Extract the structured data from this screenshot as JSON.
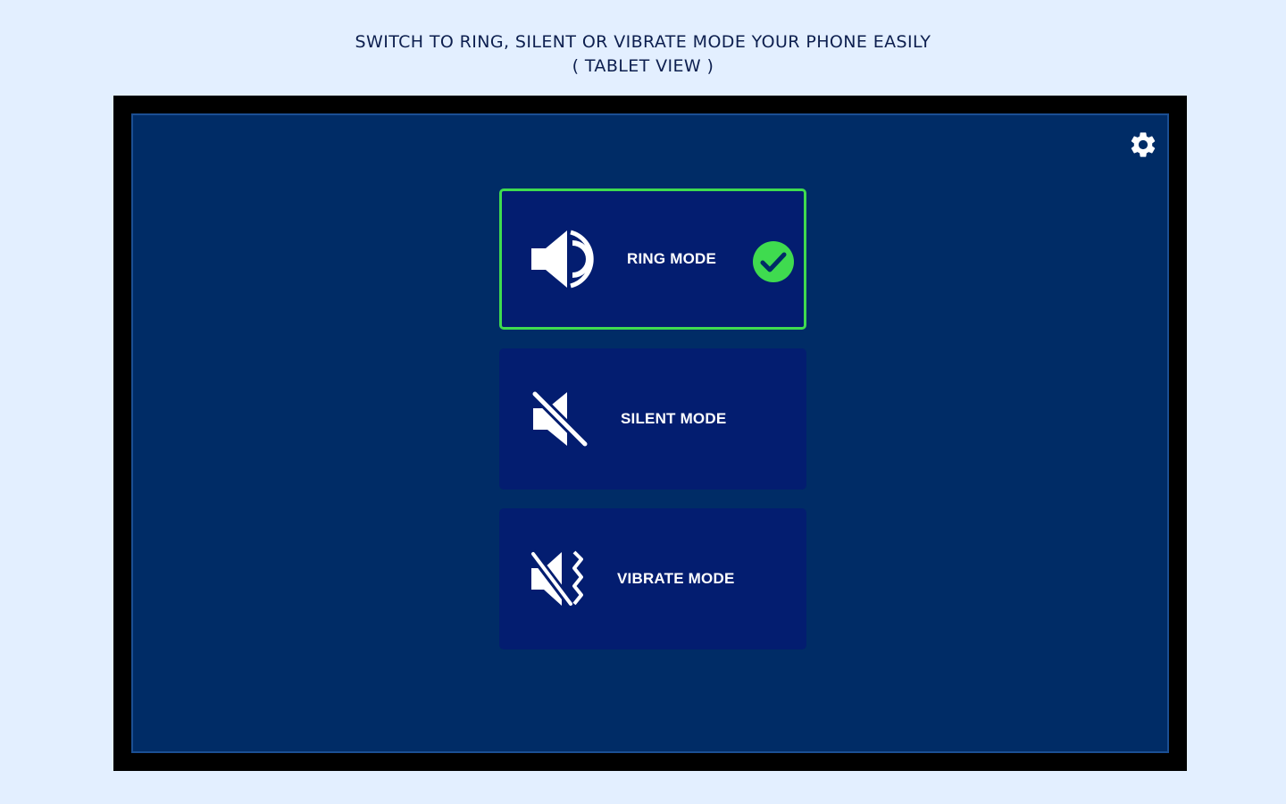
{
  "caption": {
    "line1": "SWITCH TO RING, SILENT OR VIBRATE MODE YOUR PHONE EASILY",
    "line2": "( TABLET VIEW )"
  },
  "settings": {
    "icon": "gear-icon"
  },
  "modes": [
    {
      "label": "RING MODE",
      "icon": "speaker-volume-icon",
      "selected": true
    },
    {
      "label": "SILENT MODE",
      "icon": "speaker-muted-icon",
      "selected": false
    },
    {
      "label": "VIBRATE MODE",
      "icon": "vibrate-muted-icon",
      "selected": false
    }
  ],
  "colors": {
    "page_background": "#e3efff",
    "screen_background": "#002c66",
    "card_background": "#031d70",
    "selected_border": "#3fdb4f",
    "check_green": "#3fdb4f",
    "caption_text": "#0d1f4f"
  }
}
